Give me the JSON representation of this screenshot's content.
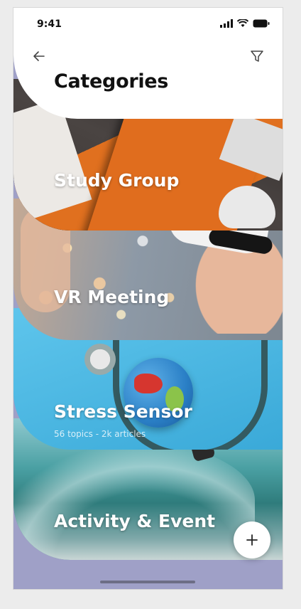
{
  "status_bar": {
    "time": "9:41",
    "icons": [
      "signal-icon",
      "wifi-icon",
      "battery-icon"
    ]
  },
  "header": {
    "title": "Categories",
    "back_icon": "arrow-left-icon",
    "filter_icon": "filter-icon"
  },
  "categories": [
    {
      "title": "Study Group",
      "subtitle": ""
    },
    {
      "title": "VR Meeting",
      "subtitle": ""
    },
    {
      "title": "Stress Sensor",
      "subtitle": "56 topics - 2k articles"
    },
    {
      "title": "Activity & Event",
      "subtitle": ""
    }
  ],
  "fab": {
    "icon": "plus-icon"
  },
  "colors": {
    "background": "#9fa0c7",
    "card_text": "#ffffff",
    "header_bg": "#ffffff"
  }
}
